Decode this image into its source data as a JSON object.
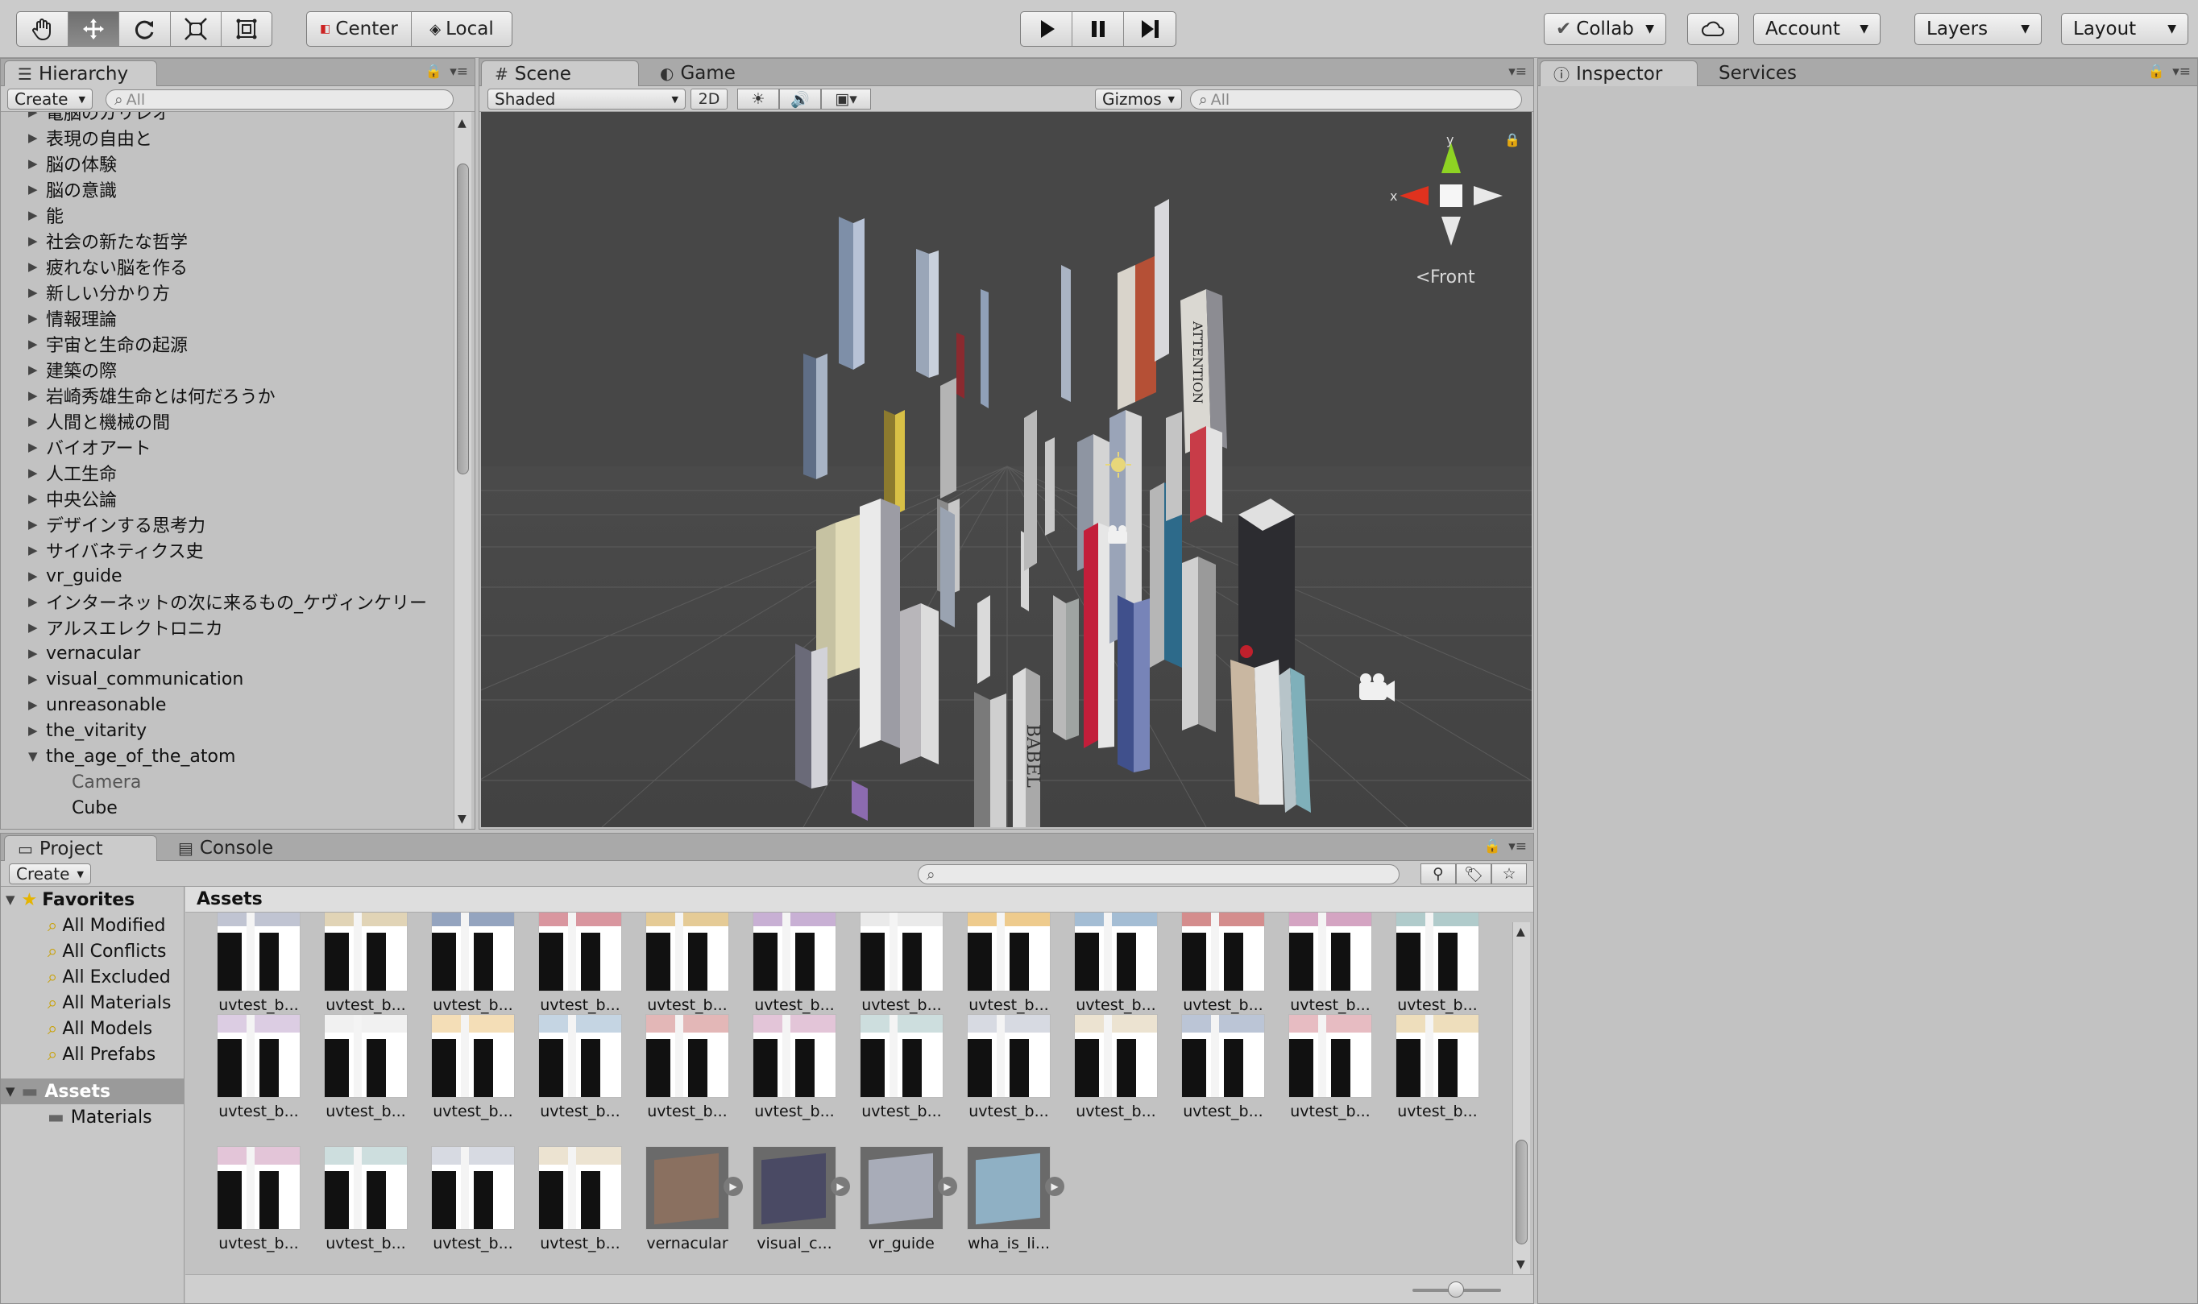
{
  "toolbar": {
    "tools": [
      "hand-tool",
      "move-tool",
      "rotate-tool",
      "scale-tool",
      "rect-tool"
    ],
    "pivot_center": "Center",
    "pivot_local": "Local",
    "collab": "Collab",
    "account": "Account",
    "layers": "Layers",
    "layout": "Layout"
  },
  "hierarchy": {
    "tab": "Hierarchy",
    "create": "Create",
    "search_placeholder": "All",
    "items": [
      {
        "label": "電脳のガリレオ"
      },
      {
        "label": "表現の自由と"
      },
      {
        "label": "脳の体験"
      },
      {
        "label": "脳の意識"
      },
      {
        "label": "能"
      },
      {
        "label": "社会の新たな哲学"
      },
      {
        "label": "疲れない脳を作る"
      },
      {
        "label": "新しい分かり方"
      },
      {
        "label": "情報理論"
      },
      {
        "label": "宇宙と生命の起源"
      },
      {
        "label": "建築の際"
      },
      {
        "label": "岩崎秀雄生命とは何だろうか"
      },
      {
        "label": "人間と機械の間"
      },
      {
        "label": "バイオアート"
      },
      {
        "label": "人工生命"
      },
      {
        "label": "中央公論"
      },
      {
        "label": "デザインする思考力"
      },
      {
        "label": "サイバネティクス史"
      },
      {
        "label": "vr_guide"
      },
      {
        "label": "インターネットの次に来るもの_ケヴィンケリー"
      },
      {
        "label": "アルスエレクトロニカ"
      },
      {
        "label": "vernacular"
      },
      {
        "label": "visual_communication"
      },
      {
        "label": "unreasonable"
      },
      {
        "label": "the_vitarity"
      },
      {
        "label": "the_age_of_the_atom",
        "expanded": true
      }
    ],
    "children": [
      "Camera",
      "Cube"
    ]
  },
  "scene": {
    "tab_scene": "Scene",
    "tab_game": "Game",
    "shading": "Shaded",
    "mode_2d": "2D",
    "gizmos": "Gizmos",
    "search_placeholder": "All",
    "gizmo_y": "y",
    "gizmo_x": "x",
    "view_label": "Front",
    "book_attention": "ATTENTION",
    "book_babel": "BABEL"
  },
  "inspector": {
    "tab_inspector": "Inspector",
    "tab_services": "Services"
  },
  "project": {
    "tab_project": "Project",
    "tab_console": "Console",
    "create": "Create",
    "favorites_label": "Favorites",
    "favorites": [
      "All Modified",
      "All Conflicts",
      "All Excluded",
      "All Materials",
      "All Models",
      "All Prefabs"
    ],
    "assets_root": "Assets",
    "materials_folder": "Materials",
    "assets_header": "Assets",
    "assets_row1": [
      "uvtest_b...",
      "uvtest_b...",
      "uvtest_b...",
      "uvtest_b...",
      "uvtest_b...",
      "uvtest_b...",
      "uvtest_b...",
      "uvtest_b...",
      "uvtest_b...",
      "uvtest_b...",
      "uvtest_b...",
      "uvtest_b..."
    ],
    "assets_row2": [
      "uvtest_b...",
      "uvtest_b...",
      "uvtest_b...",
      "uvtest_b...",
      "uvtest_b...",
      "uvtest_b...",
      "uvtest_b...",
      "uvtest_b...",
      "uvtest_b...",
      "uvtest_b...",
      "uvtest_b...",
      "uvtest_b..."
    ],
    "assets_row3": [
      "uvtest_b...",
      "uvtest_b...",
      "uvtest_b...",
      "uvtest_b...",
      "vernacular",
      "visual_c...",
      "vr_guide",
      "wha_is_li..."
    ]
  },
  "colors": {
    "scene_bg": "#474747",
    "gizmo_x": "#e0321e",
    "gizmo_y": "#8ed323",
    "selection": "#3d6fb6"
  }
}
